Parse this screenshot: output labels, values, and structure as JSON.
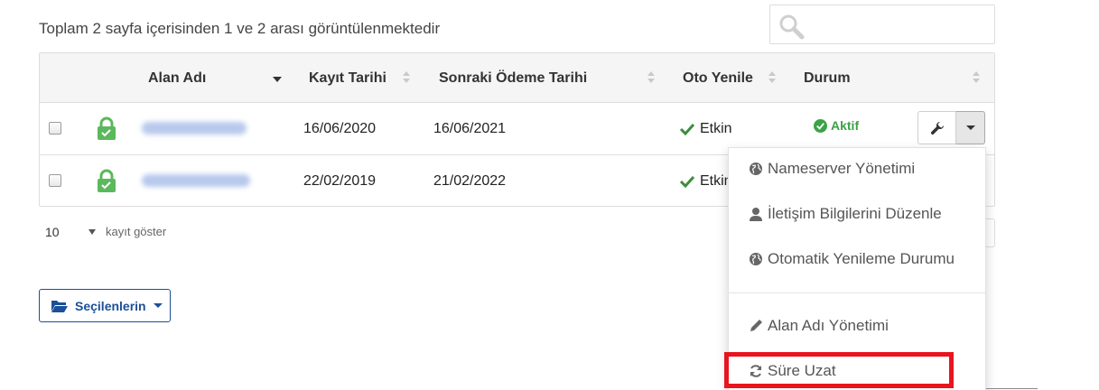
{
  "summary": "Toplam 2 sayfa içerisinden 1 ve 2 arası görüntülenmektedir",
  "search": {
    "placeholder": ""
  },
  "table": {
    "headers": {
      "domain": "Alan Adı",
      "reg_date": "Kayıt Tarihi",
      "next_payment": "Sonraki Ödeme Tarihi",
      "auto_renew": "Oto Yenile",
      "status": "Durum"
    },
    "rows": [
      {
        "reg_date": "16/06/2020",
        "next_payment": "16/06/2021",
        "auto_renew": "Etkin",
        "status": "Aktif"
      },
      {
        "reg_date": "22/02/2019",
        "next_payment": "21/02/2022",
        "auto_renew": "Etkin"
      }
    ]
  },
  "perpage": {
    "value": "10",
    "label": "kayıt göster"
  },
  "selected_button": "Seçilenlerin",
  "dropdown": {
    "items": [
      {
        "icon": "globe-icon",
        "label": "Nameserver Yönetimi"
      },
      {
        "icon": "user-icon",
        "label": "İletişim Bilgilerini Düzenle"
      },
      {
        "icon": "globe-icon",
        "label": "Otomatik Yenileme Durumu"
      },
      {
        "icon": "pencil-icon",
        "label": "Alan Adı Yönetimi"
      },
      {
        "icon": "refresh-icon",
        "label": "Süre Uzat"
      }
    ]
  },
  "colors": {
    "active_green": "#3aa346",
    "lock_green": "#5cb85c",
    "primary_blue": "#1c4f9a",
    "highlight_red": "#e8141e"
  }
}
